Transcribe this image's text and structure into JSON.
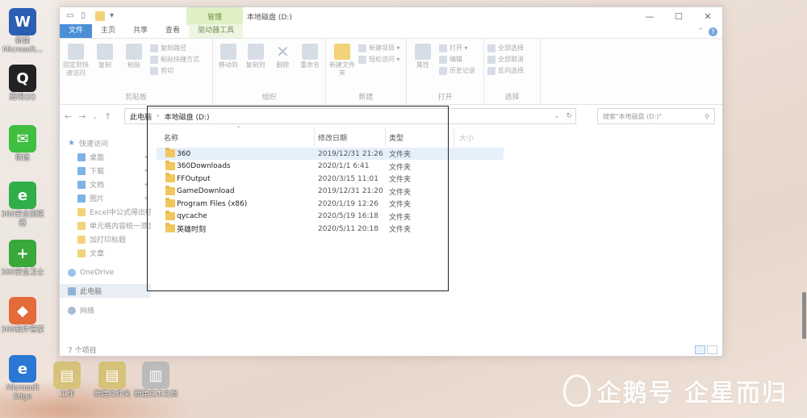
{
  "desktop": {
    "icons": [
      {
        "label": "新建 Microsoft...",
        "glyph": "W",
        "color": "#2b5fb4"
      },
      {
        "label": "腾讯QQ",
        "glyph": "Q",
        "color": "#222222"
      },
      {
        "label": "微信",
        "glyph": "✉",
        "color": "#3fbf3f"
      },
      {
        "label": "360安全浏览器",
        "glyph": "e",
        "color": "#2fae4a"
      },
      {
        "label": "360安全卫士",
        "glyph": "+",
        "color": "#3aa83a"
      },
      {
        "label": "360软件管家",
        "glyph": "◆",
        "color": "#e46a3a"
      },
      {
        "label": "Microsoft Edge",
        "glyph": "e",
        "color": "#2a78d4"
      },
      {
        "label": "工作",
        "glyph": "▤",
        "color": "#d7c27a"
      },
      {
        "label": "新建文件夹",
        "glyph": "▤",
        "color": "#d7c27a"
      },
      {
        "label": "新建文本文档",
        "glyph": "▥",
        "color": "#bbbbbb"
      }
    ],
    "watermark": "企鹅号 企星而归"
  },
  "window": {
    "context_tab_title": "管理",
    "title": "本地磁盘 (D:)",
    "controls": {
      "minimize": "—",
      "maximize": "☐",
      "close": "✕"
    }
  },
  "ribbon_tabs": [
    "文件",
    "主页",
    "共享",
    "查看",
    "驱动器工具"
  ],
  "ribbon": {
    "clipboard": {
      "label": "剪贴板",
      "pin": "固定到快速访问",
      "copy": "复制",
      "paste": "粘贴",
      "copy_path": "复制路径",
      "paste_shortcut": "粘贴快捷方式",
      "cut": "剪切"
    },
    "organize": {
      "label": "组织",
      "move_to": "移动到",
      "copy_to": "复制到",
      "delete": "删除",
      "rename": "重命名"
    },
    "new": {
      "label": "新建",
      "new_folder": "新建文件夹",
      "new_item": "新建项目 ▾",
      "easy_access": "轻松访问 ▾"
    },
    "open": {
      "label": "打开",
      "properties": "属性",
      "open": "打开 ▾",
      "edit": "编辑",
      "history": "历史记录"
    },
    "select": {
      "label": "选择",
      "select_all": "全部选择",
      "select_none": "全部取消",
      "invert": "反向选择"
    }
  },
  "address": {
    "breadcrumb": [
      "此电脑",
      "本地磁盘 (D:)"
    ],
    "separator": "›",
    "search_placeholder": "搜索\"本地磁盘 (D:)\""
  },
  "nav_pane": {
    "items": [
      {
        "label": "快速访问",
        "icon": "star",
        "level": 0,
        "pinned": false
      },
      {
        "label": "桌面",
        "icon": "blue",
        "level": 1,
        "pinned": true
      },
      {
        "label": "下载",
        "icon": "blue",
        "level": 1,
        "pinned": true
      },
      {
        "label": "文档",
        "icon": "blue",
        "level": 1,
        "pinned": true
      },
      {
        "label": "图片",
        "icon": "blue",
        "level": 1,
        "pinned": true
      },
      {
        "label": "Excel中公式得出结",
        "icon": "folder",
        "level": 1,
        "pinned": false
      },
      {
        "label": "单元格内容统一添加",
        "icon": "folder",
        "level": 1,
        "pinned": false
      },
      {
        "label": "加打印标题",
        "icon": "folder",
        "level": 1,
        "pinned": false
      },
      {
        "label": "文章",
        "icon": "folder",
        "level": 1,
        "pinned": false
      },
      {
        "label": "OneDrive",
        "icon": "cloud",
        "level": 0,
        "pinned": false
      },
      {
        "label": "此电脑",
        "icon": "pc",
        "level": 0,
        "pinned": false,
        "selected": true
      },
      {
        "label": "网络",
        "icon": "net",
        "level": 0,
        "pinned": false
      }
    ]
  },
  "columns": {
    "name": "名称",
    "date": "修改日期",
    "type": "类型",
    "size": "大小"
  },
  "files": [
    {
      "name": "360",
      "date": "2019/12/31 21:26",
      "type": "文件夹",
      "selected": true
    },
    {
      "name": "360Downloads",
      "date": "2020/1/1 6:41",
      "type": "文件夹"
    },
    {
      "name": "FFOutput",
      "date": "2020/3/15 11:01",
      "type": "文件夹"
    },
    {
      "name": "GameDownload",
      "date": "2019/12/31 21:20",
      "type": "文件夹"
    },
    {
      "name": "Program Files (x86)",
      "date": "2020/1/19 12:26",
      "type": "文件夹"
    },
    {
      "name": "qycache",
      "date": "2020/5/19 16:18",
      "type": "文件夹"
    },
    {
      "name": "英雄时刻",
      "date": "2020/5/11 20:18",
      "type": "文件夹"
    }
  ],
  "status": {
    "item_count": "7 个项目"
  }
}
